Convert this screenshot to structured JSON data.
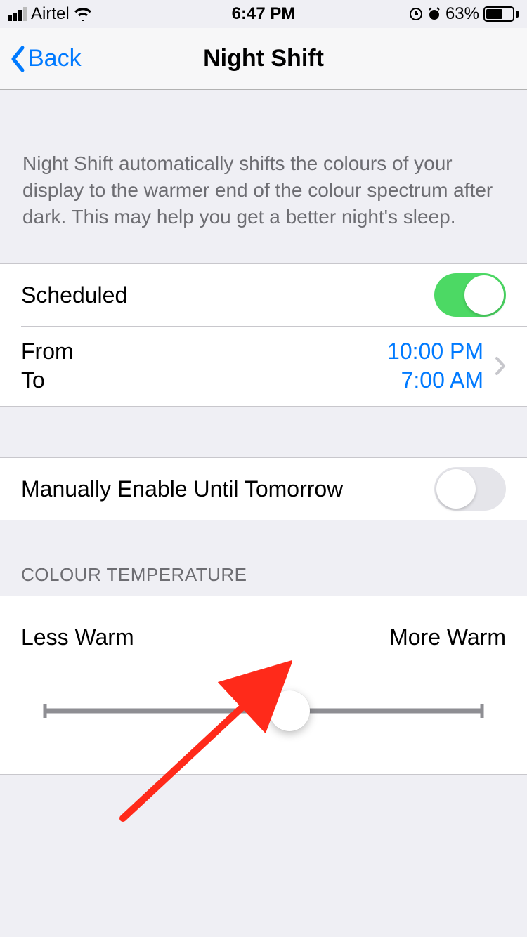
{
  "status": {
    "carrier": "Airtel",
    "time": "6:47 PM",
    "battery_pct": "63%",
    "battery_fill_pct": 63
  },
  "nav": {
    "back_label": "Back",
    "title": "Night Shift"
  },
  "description": "Night Shift automatically shifts the colours of your display to the warmer end of the colour spectrum after dark. This may help you get a better night's sleep.",
  "scheduled": {
    "label": "Scheduled",
    "enabled": true,
    "from_label": "From",
    "to_label": "To",
    "from_time": "10:00 PM",
    "to_time": "7:00 AM"
  },
  "manual": {
    "label": "Manually Enable Until Tomorrow",
    "enabled": false
  },
  "temperature": {
    "header": "COLOUR TEMPERATURE",
    "less_label": "Less Warm",
    "more_label": "More Warm",
    "value_pct": 56
  }
}
